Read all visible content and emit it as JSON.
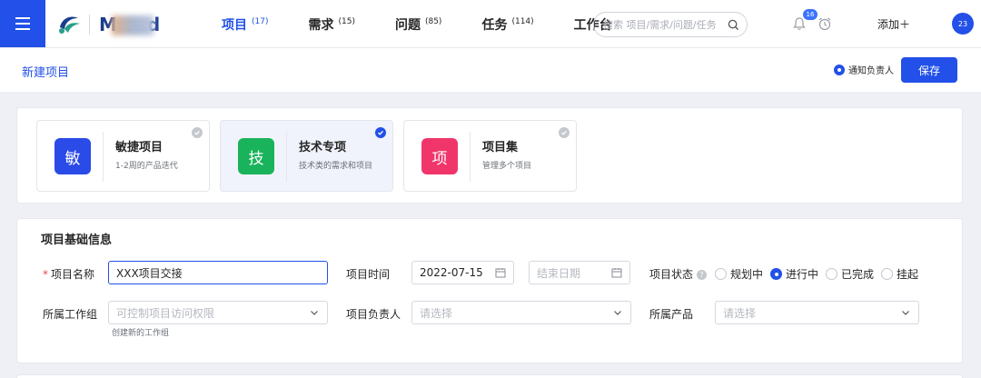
{
  "nav": {
    "logo_text": "M      oud",
    "items": [
      {
        "label": "项目",
        "count": "(17)",
        "active": true
      },
      {
        "label": "需求",
        "count": "(15)",
        "active": false
      },
      {
        "label": "问题",
        "count": "(85)",
        "active": false
      },
      {
        "label": "任务",
        "count": "(114)",
        "active": false
      },
      {
        "label": "工作台",
        "count": "",
        "active": false
      }
    ],
    "search_placeholder": "搜索 项目/需求/问题/任务",
    "notification_count": "16",
    "add_label": "添加＋",
    "avatar_text": "23"
  },
  "header": {
    "title": "新建项目",
    "notify_label": "通知负责人",
    "save_label": "保存"
  },
  "project_types": [
    {
      "icon_char": "敏",
      "title": "敏捷项目",
      "desc": "1-2周的产品迭代",
      "color": "#2a4be8",
      "selected": false
    },
    {
      "icon_char": "技",
      "title": "技术专项",
      "desc": "技术类的需求和项目",
      "color": "#19b35c",
      "selected": true
    },
    {
      "icon_char": "项",
      "title": "项目集",
      "desc": "管理多个项目",
      "color": "#f0356a",
      "selected": false
    }
  ],
  "form": {
    "section_title": "项目基础信息",
    "name_label": "项目名称",
    "name_value": "XXX项目交接",
    "time_label": "项目时间",
    "start_date": "2022-07-15",
    "end_placeholder": "结束日期",
    "status_label": "项目状态",
    "status_options": [
      {
        "label": "规划中",
        "checked": false
      },
      {
        "label": "进行中",
        "checked": true
      },
      {
        "label": "已完成",
        "checked": false
      },
      {
        "label": "挂起",
        "checked": false
      }
    ],
    "workgroup_label": "所属工作组",
    "workgroup_placeholder": "可控制项目访问权限",
    "workgroup_hint": "创建新的工作组",
    "owner_label": "项目负责人",
    "owner_placeholder": "请选择",
    "product_label": "所属产品",
    "product_placeholder": "请选择"
  },
  "colors": {
    "accent": "#2250e8",
    "required": "#e5484d"
  }
}
